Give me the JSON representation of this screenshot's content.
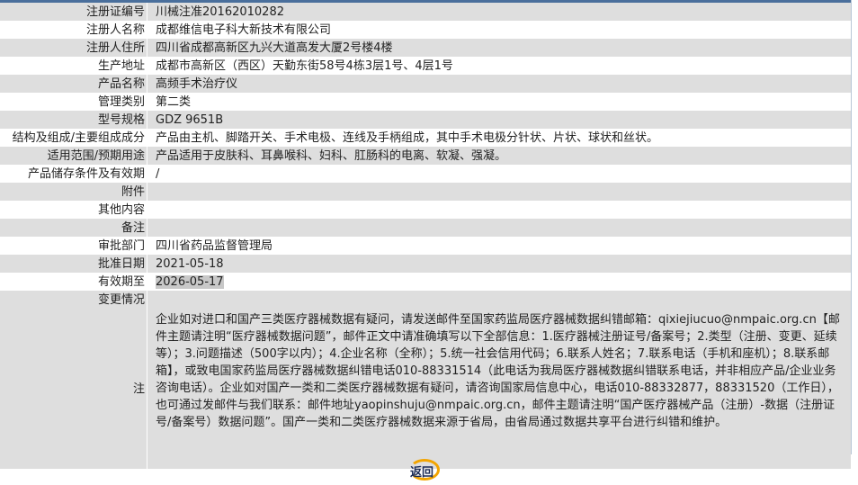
{
  "rows": [
    {
      "label": "注册证编号",
      "value": "川械注准20162010282"
    },
    {
      "label": "注册人名称",
      "value": "成都维信电子科大新技术有限公司"
    },
    {
      "label": "注册人住所",
      "value": "四川省成都高新区九兴大道高发大厦2号楼4楼"
    },
    {
      "label": "生产地址",
      "value": "成都市高新区（西区）天勤东街58号4栋3层1号、4层1号"
    },
    {
      "label": "产品名称",
      "value": "高频手术治疗仪"
    },
    {
      "label": "管理类别",
      "value": "第二类"
    },
    {
      "label": "型号规格",
      "value": "GDZ 9651B"
    },
    {
      "label": "结构及组成/主要组成成分",
      "value": "产品由主机、脚踏开关、手术电极、连线及手柄组成，其中手术电极分针状、片状、球状和丝状。"
    },
    {
      "label": "适用范围/预期用途",
      "value": "产品适用于皮肤科、耳鼻喉科、妇科、肛肠科的电离、软凝、强凝。"
    },
    {
      "label": "产品储存条件及有效期",
      "value": "/"
    },
    {
      "label": "附件",
      "value": ""
    },
    {
      "label": "其他内容",
      "value": ""
    },
    {
      "label": "备注",
      "value": ""
    },
    {
      "label": "审批部门",
      "value": "四川省药品监督管理局"
    },
    {
      "label": "批准日期",
      "value": "2021-05-18"
    },
    {
      "label": "有效期至",
      "value": "2026-05-17"
    },
    {
      "label": "变更情况",
      "value": ""
    }
  ],
  "note": {
    "label": "注",
    "text": "企业如对进口和国产三类医疗器械数据有疑问，请发送邮件至国家药监局医疗器械数据纠错邮箱：qixiejiucuo@nmpaic.org.cn【邮件主题请注明“医疗器械数据问题”，邮件正文中请准确填写以下全部信息：1.医疗器械注册证号/备案号；2.类型（注册、变更、延续等）；3.问题描述（500字以内）；4.企业名称（全称）；5.统一社会信用代码；6.联系人姓名；7.联系电话（手机和座机）；8.联系邮箱】，或致电国家药监局医疗器械数据纠错电话010-88331514（此电话为我局医疗器械数据纠错联系电话，并非相应产品/企业业务咨询电话）。企业如对国产一类和二类医疗器械数据有疑问，请咨询国家局信息中心，电话010-88332877，88331520（工作日），也可通过发邮件与我们联系：邮件地址yaopinshuju@nmpaic.org.cn，邮件主题请注明“国产医疗器械产品（注册）-数据（注册证号/备案号）数据问题”。国产一类和二类医疗器械数据来源于省局，由省局通过数据共享平台进行纠错和维护。"
  },
  "back_button": {
    "label": "返回"
  },
  "colors": {
    "row_alt": "#dedede",
    "accent": "#f2a400",
    "top_bar": "#4a6f9c"
  }
}
